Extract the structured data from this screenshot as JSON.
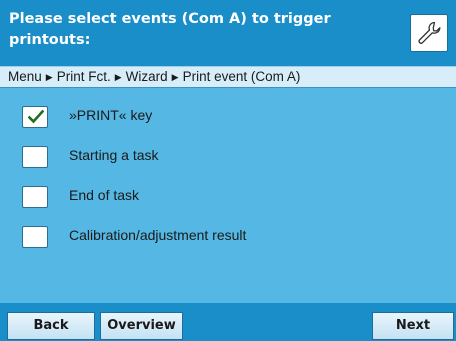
{
  "header": {
    "title": "Please select events (Com A) to trigger printouts:",
    "settings_icon": "wrench-icon"
  },
  "breadcrumb": {
    "items": [
      "Menu",
      "Print Fct.",
      "Wizard",
      "Print event (Com A)"
    ],
    "separator": "▶"
  },
  "options": [
    {
      "label": "»PRINT« key",
      "checked": true
    },
    {
      "label": "Starting a task",
      "checked": false
    },
    {
      "label": "End of task",
      "checked": false
    },
    {
      "label": "Calibration/adjustment result",
      "checked": false
    }
  ],
  "footer": {
    "back_label": "Back",
    "overview_label": "Overview",
    "next_label": "Next"
  },
  "colors": {
    "header_bg": "#198ec8",
    "content_bg": "#55b7e3",
    "breadcrumb_bg": "#d7eefa",
    "check_color": "#1f6e1f"
  }
}
